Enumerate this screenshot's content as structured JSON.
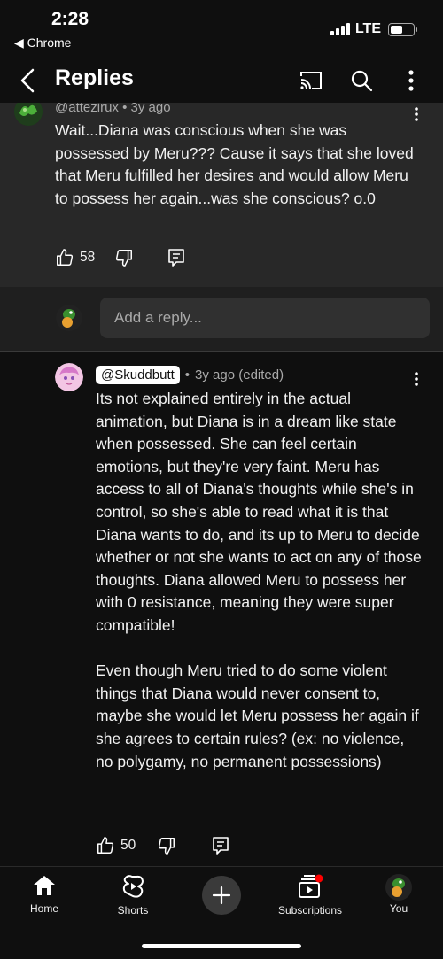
{
  "status_bar": {
    "time": "2:28",
    "back_app": "◀ Chrome",
    "network": "LTE"
  },
  "app_bar": {
    "title": "Replies"
  },
  "parent_comment": {
    "handle": "@attezirux",
    "age": "3y ago",
    "text": "Wait...Diana was conscious when she was possessed by Meru??? Cause it says that she loved that Meru fulfilled her desires and would allow Meru to possess her again...was she conscious? o.0",
    "likes": "58"
  },
  "reply_box": {
    "placeholder": "Add a reply..."
  },
  "reply": {
    "handle": "@Skuddbutt",
    "age": "3y ago (edited)",
    "text": "Its not explained entirely in the actual animation, but Diana is in a dream like state when possessed. She can feel certain emotions, but they're very faint. Meru has access to all of Diana's thoughts while she's in control, so she's able to read what it is that Diana wants to do, and its up to Meru to decide whether or not she wants to act on any of those thoughts. Diana allowed Meru to possess her with 0 resistance, meaning they were super compatible!\n\nEven though Meru tried to do some violent things that Diana would never consent to, maybe she would let Meru possess her again if she agrees to certain rules? (ex: no violence, no polygamy, no permanent possessions)",
    "likes": "50"
  },
  "bottom_nav": {
    "home": "Home",
    "shorts": "Shorts",
    "subscriptions": "Subscriptions",
    "you": "You"
  },
  "colors": {
    "background": "#0f0f0f",
    "parent_bg": "#282828",
    "notification_dot": "#ff0000",
    "avatar_green": "#3a8f2f"
  }
}
